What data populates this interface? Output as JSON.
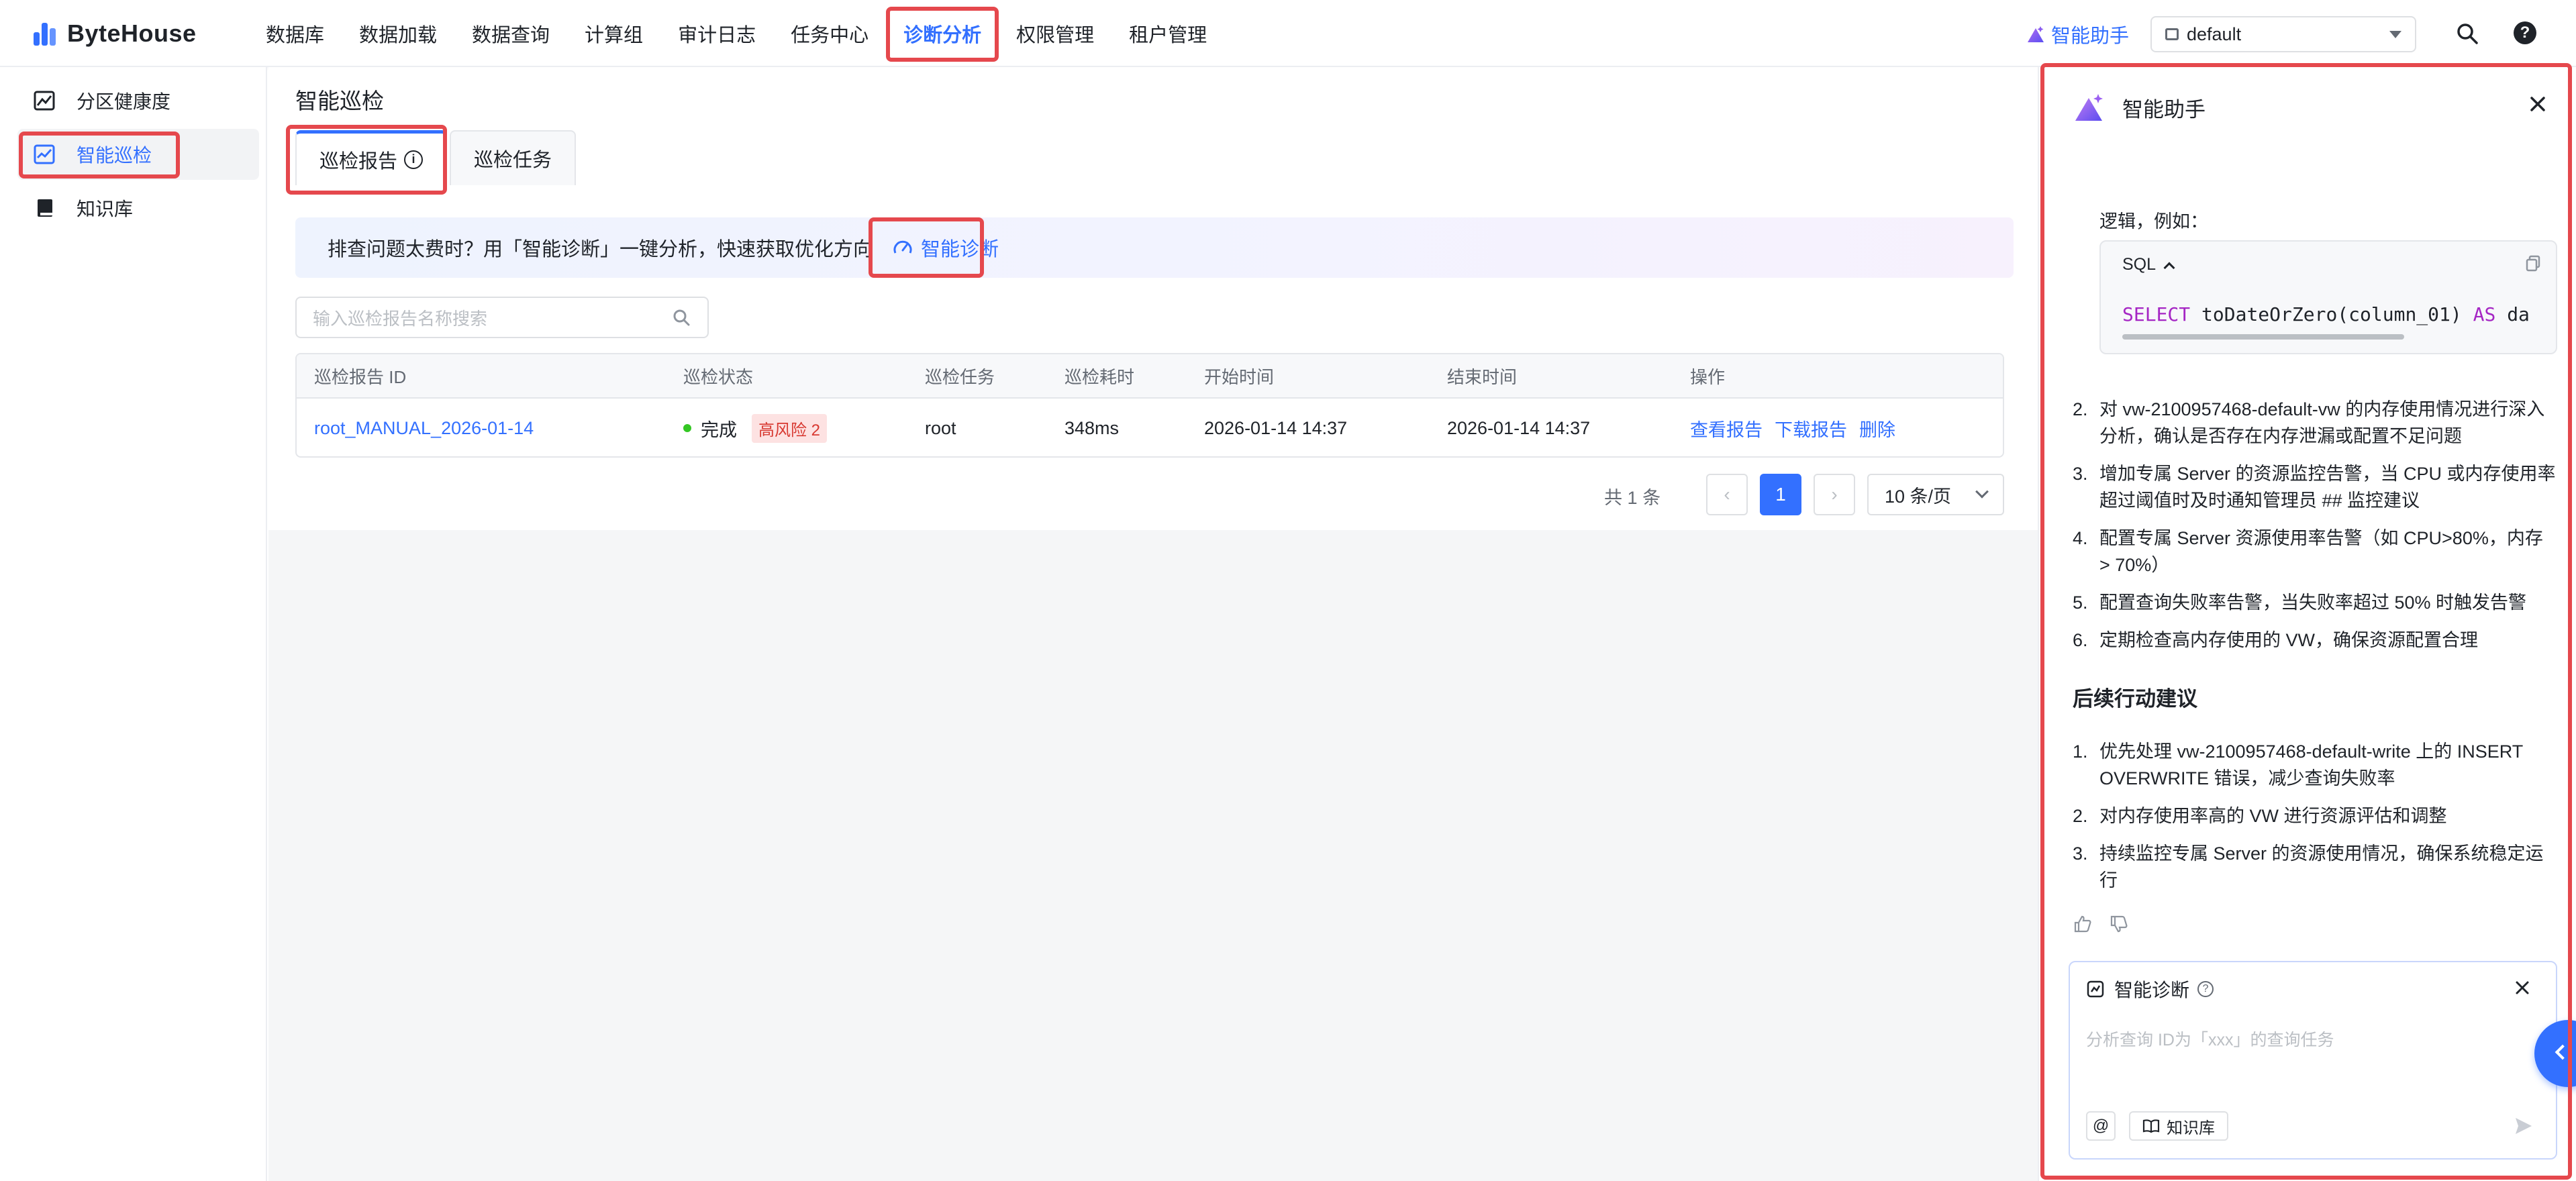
{
  "brand": {
    "name": "ByteHouse",
    "accent": "#3370ff",
    "highlight": "#e5484d"
  },
  "nav": {
    "items": [
      "数据库",
      "数据加载",
      "数据查询",
      "计算组",
      "审计日志",
      "任务中心",
      "诊断分析",
      "权限管理",
      "租户管理"
    ],
    "active": "诊断分析",
    "assistant_label": "智能助手",
    "workspace": "default"
  },
  "sidebar": {
    "items": [
      {
        "label": "分区健康度",
        "icon": "image-chart-icon"
      },
      {
        "label": "智能巡检",
        "icon": "line-chart-icon",
        "active": true
      },
      {
        "label": "知识库",
        "icon": "book-icon"
      }
    ]
  },
  "main": {
    "title": "智能巡检",
    "tabs": [
      {
        "label": "巡检报告",
        "active": true,
        "info_icon": "ⓘ"
      },
      {
        "label": "巡检任务"
      }
    ],
    "banner": {
      "text": "排查问题太费时？用「智能诊断」一键分析，快速获取优化方向",
      "link": "智能诊断"
    },
    "search_placeholder": "输入巡检报告名称搜索",
    "table": {
      "columns": [
        "巡检报告 ID",
        "巡检状态",
        "巡检任务",
        "巡检耗时",
        "开始时间",
        "结束时间",
        "操作"
      ],
      "rows": [
        {
          "id": "root_MANUAL_2026-01-14",
          "status": "完成",
          "risk": "高风险 2",
          "task": "root",
          "duration": "348ms",
          "start": "2026-01-14 14:37",
          "end": "2026-01-14 14:37",
          "actions": [
            "查看报告",
            "下载报告",
            "删除"
          ]
        }
      ]
    },
    "pagination": {
      "total_prefix": "共",
      "total": "1",
      "total_suffix": "条",
      "prev": "‹",
      "current": "1",
      "next": "›",
      "page_size": "10 条/页"
    }
  },
  "assistant": {
    "title": "智能助手",
    "intro": "逻辑，例如：",
    "code": {
      "lang": "SQL",
      "kw1": "SELECT",
      "expr": "toDateOrZero(column_01)",
      "kw2": "AS",
      "tail": "da"
    },
    "list1": [
      "对 vw-2100957468-default-vw 的内存使用情况进行深入分析，确认是否存在内存泄漏或配置不足问题",
      "增加专属 Server 的资源监控告警，当 CPU 或内存使用率超过阈值时及时通知管理员 ## 监控建议",
      "配置专属 Server 资源使用率告警（如 CPU>80%，内存 > 70%）",
      "配置查询失败率告警，当失败率超过 50% 时触发告警",
      "定期检查高内存使用的 VW，确保资源配置合理"
    ],
    "list1_start": [
      "2.",
      "3.",
      "4.",
      "5.",
      "6."
    ],
    "section_title": "后续行动建议",
    "list2": [
      "优先处理 vw-2100957468-default-write 上的 INSERT OVERWRITE 错误，减少查询失败率",
      "对内存使用率高的 VW 进行资源评估和调整",
      "持续监控专属 Server 的资源使用情况，确保系统稳定运行"
    ],
    "list2_nums": [
      "1.",
      "2.",
      "3."
    ],
    "diag": {
      "title": "智能诊断",
      "placeholder": "分析查询 ID为「xxx」的查询任务",
      "at": "@",
      "kb": "知识库"
    }
  }
}
